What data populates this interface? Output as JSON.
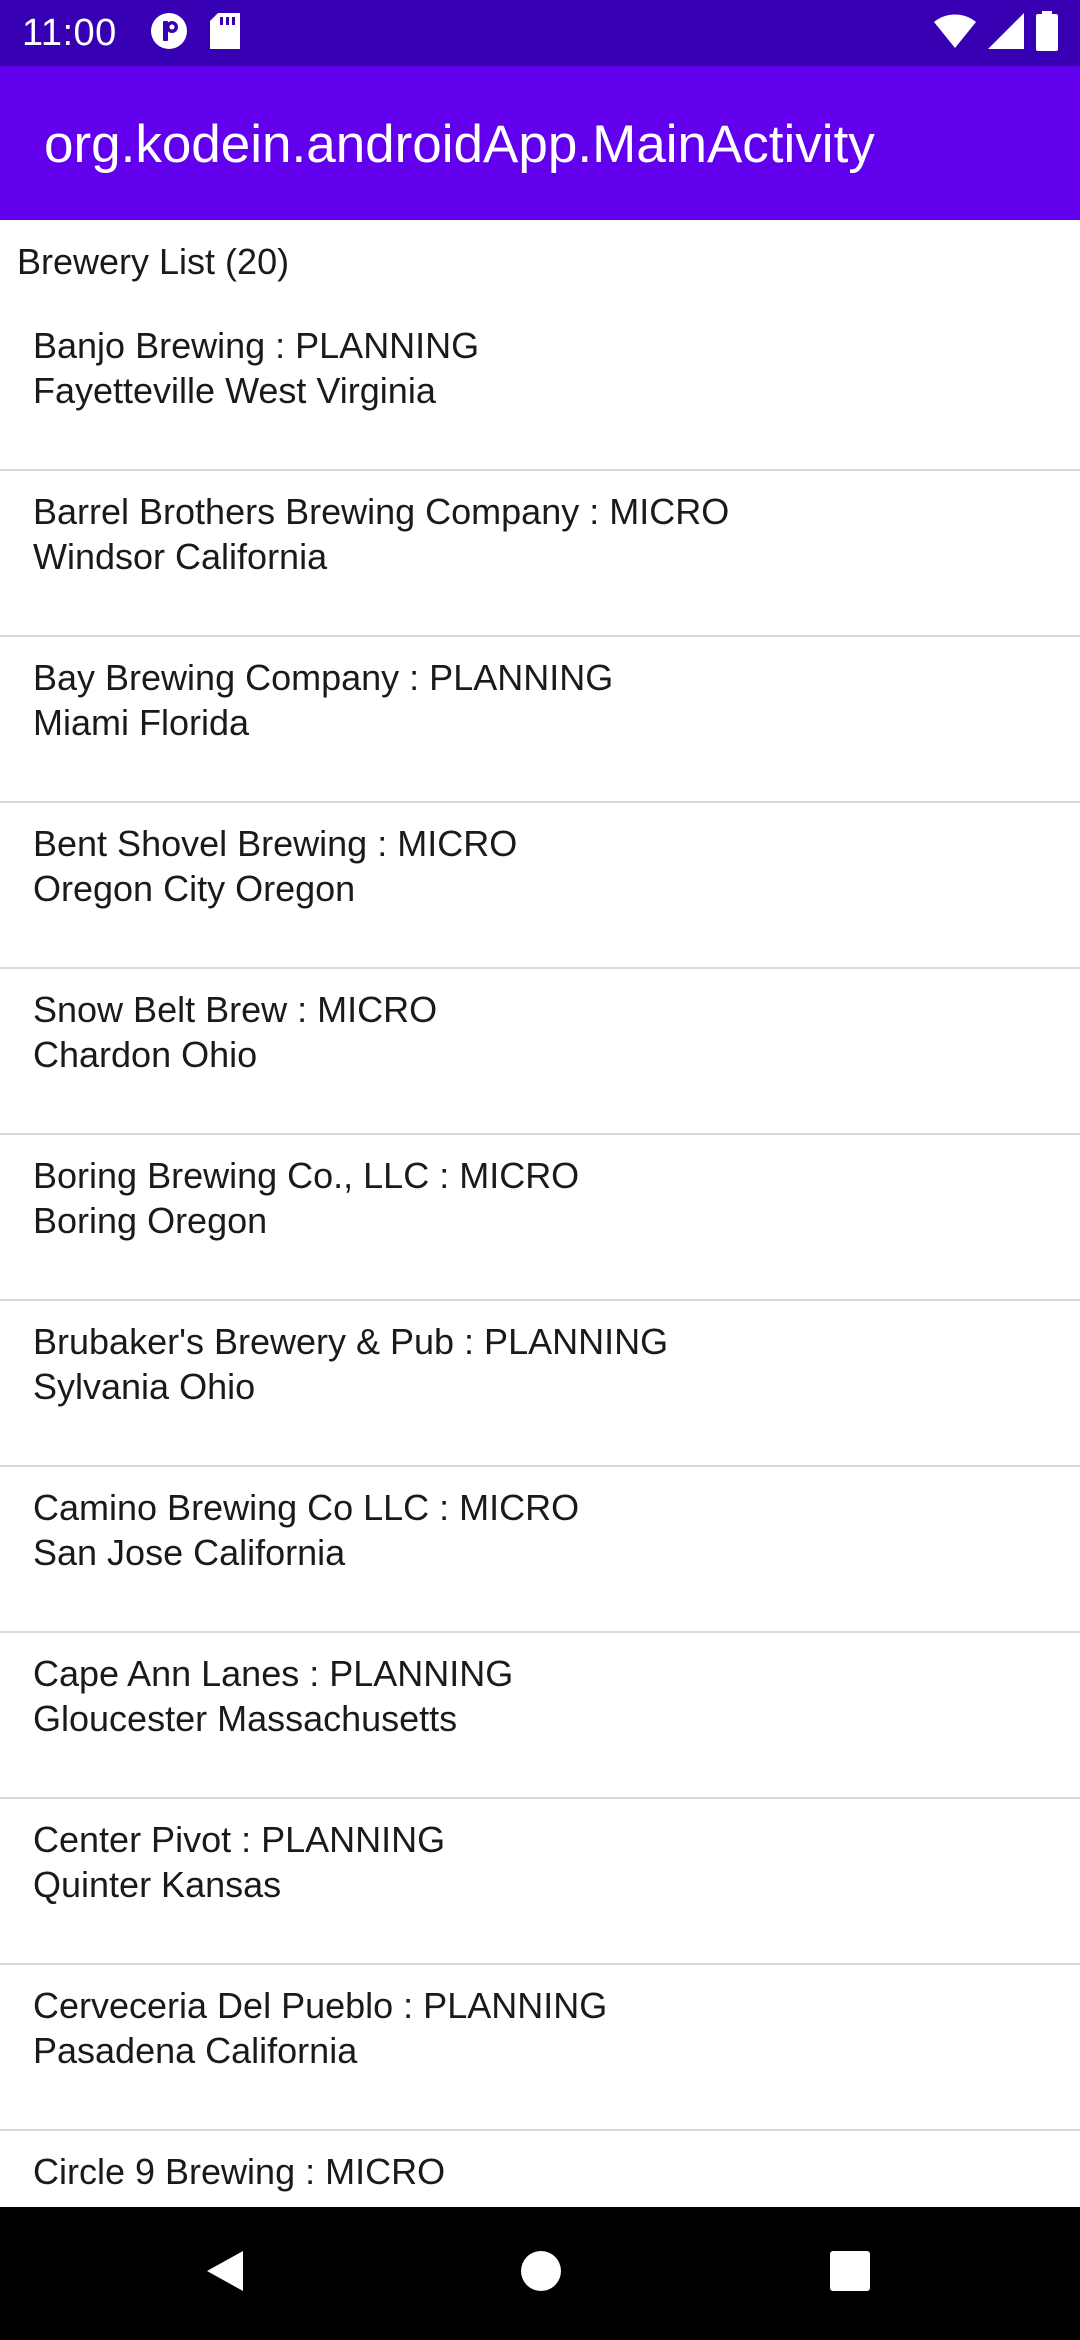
{
  "status_bar": {
    "time": "11:00",
    "icons_left": [
      "sync-icon",
      "sd-card-icon"
    ],
    "icons_right": [
      "wifi-icon",
      "cell-signal-icon",
      "battery-icon"
    ],
    "color": "#3700b3"
  },
  "app_bar": {
    "title": "org.kodein.androidApp.MainActivity",
    "color": "#6200ee"
  },
  "list": {
    "header": "Brewery List (20)",
    "items": [
      {
        "title": "Banjo Brewing : PLANNING",
        "subtitle": "Fayetteville West Virginia"
      },
      {
        "title": "Barrel Brothers Brewing Company : MICRO",
        "subtitle": "Windsor California"
      },
      {
        "title": "Bay Brewing Company : PLANNING",
        "subtitle": "Miami Florida"
      },
      {
        "title": "Bent Shovel Brewing : MICRO",
        "subtitle": "Oregon City Oregon"
      },
      {
        "title": "Snow Belt Brew : MICRO",
        "subtitle": "Chardon Ohio"
      },
      {
        "title": "Boring Brewing Co., LLC : MICRO",
        "subtitle": "Boring Oregon"
      },
      {
        "title": "Brubaker's Brewery & Pub : PLANNING",
        "subtitle": "Sylvania Ohio"
      },
      {
        "title": "Camino Brewing Co LLC : MICRO",
        "subtitle": "San Jose California"
      },
      {
        "title": "Cape Ann Lanes : PLANNING",
        "subtitle": "Gloucester Massachusetts"
      },
      {
        "title": "Center Pivot : PLANNING",
        "subtitle": "Quinter Kansas"
      },
      {
        "title": "Cerveceria Del Pueblo : PLANNING",
        "subtitle": "Pasadena California"
      },
      {
        "title": "Circle 9 Brewing : MICRO",
        "subtitle": ""
      }
    ]
  },
  "nav_bar": {
    "buttons": [
      "back-icon",
      "home-icon",
      "recents-icon"
    ]
  }
}
